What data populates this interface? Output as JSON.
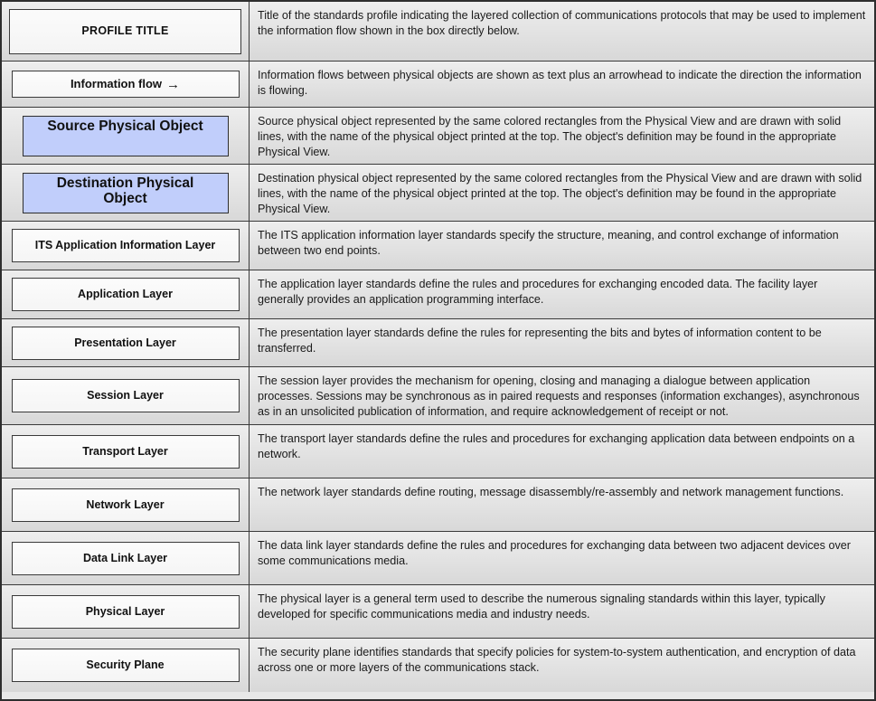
{
  "legend": {
    "rows": [
      {
        "symbol_label": "PROFILE TITLE",
        "symbol_kind": "profile-title",
        "description": "Title of the standards profile indicating the layered collection of communications protocols that may be used to implement the information flow shown in the box directly below."
      },
      {
        "symbol_label": "Information flow",
        "symbol_arrow": "→",
        "symbol_kind": "information-flow",
        "description": "Information flows between physical objects are shown as text plus an arrowhead to indicate the direction the information is flowing."
      },
      {
        "symbol_label": "Source Physical Object",
        "symbol_kind": "source-physical-object",
        "description": "Source physical object represented by the same colored rectangles from the Physical View and are drawn with solid lines, with the name of the physical object printed at the top. The object's definition may be found in the appropriate Physical View."
      },
      {
        "symbol_label": "Destination Physical Object",
        "symbol_kind": "destination-physical-object",
        "description": "Destination physical object represented by the same colored rectangles from the Physical View and are drawn with solid lines, with the name of the physical object printed at the top. The object's definition may be found in the appropriate Physical View."
      },
      {
        "symbol_label": "ITS Application Information Layer",
        "symbol_kind": "layer",
        "description": "The ITS application information layer standards specify the structure, meaning, and control exchange of information between two end points."
      },
      {
        "symbol_label": "Application Layer",
        "symbol_kind": "layer",
        "description": "The application layer standards define the rules and procedures for exchanging encoded data.  The facility layer generally provides an application programming interface."
      },
      {
        "symbol_label": "Presentation Layer",
        "symbol_kind": "layer",
        "description": "The presentation layer standards define the rules for representing the bits and bytes of information content to be transferred."
      },
      {
        "symbol_label": "Session Layer",
        "symbol_kind": "layer",
        "description": "The session layer provides the mechanism for opening, closing and managing a dialogue between application processes.   Sessions may be synchronous as in paired requests and responses (information exchanges), asynchronous as in an unsolicited publication of information, and require acknowledgement of receipt or not."
      },
      {
        "symbol_label": "Transport Layer",
        "symbol_kind": "layer",
        "description": "The transport layer standards define the rules and procedures for exchanging application data between endpoints on a network."
      },
      {
        "symbol_label": "Network Layer",
        "symbol_kind": "layer",
        "description": "The network layer standards define routing, message disassembly/re-assembly and network management functions."
      },
      {
        "symbol_label": "Data Link Layer",
        "symbol_kind": "layer",
        "description": "The data link layer standards define the rules and procedures for exchanging data between two adjacent devices over some communications media."
      },
      {
        "symbol_label": "Physical Layer",
        "symbol_kind": "layer",
        "description": "The physical layer is a general term used to describe the numerous signaling standards within this layer, typically developed for specific communications media and industry needs."
      },
      {
        "symbol_label": "Security Plane",
        "symbol_kind": "layer",
        "description": "The security plane identifies standards that specify policies for system-to-system authentication, and encryption of data across one or more layers of the communications stack."
      }
    ]
  },
  "colors": {
    "physical_object_fill": "#c1cefb",
    "row_background_top": "#eeeeee",
    "row_background_bottom": "#d8d8d8",
    "border": "#3a3a3a",
    "outer_border": "#2e2e2e",
    "text": "#111111"
  }
}
